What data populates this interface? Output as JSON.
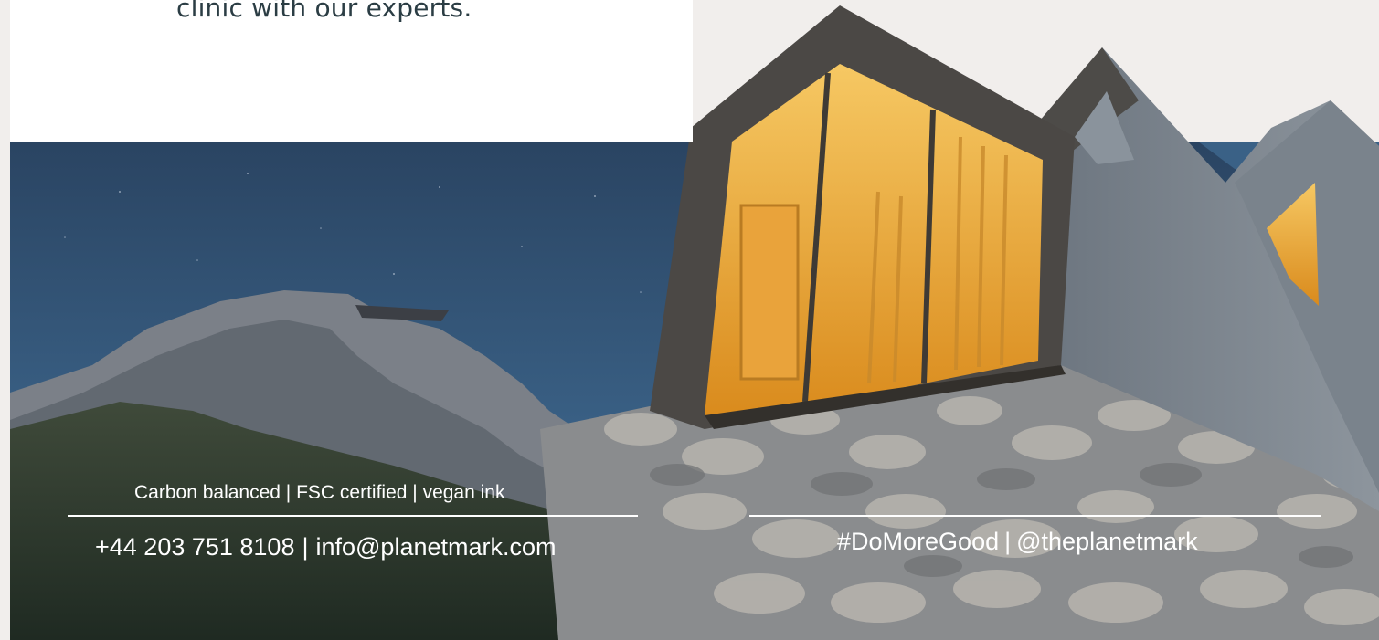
{
  "hero": {
    "tagline": "clinic with our experts."
  },
  "footer": {
    "cert_text": "Carbon balanced | FSC certified | vegan ink",
    "contact": {
      "phone": "+44 203 751 8108",
      "separator": "|",
      "email": "info@planetmark.com"
    },
    "social": {
      "hashtag": "#DoMoreGood",
      "separator": "|",
      "handle": "@theplanetmark"
    }
  },
  "colors": {
    "page_bg": "#f1eeec",
    "card_bg": "#ffffff",
    "text_dark": "#2b3d44",
    "sky_top": "#2b4565",
    "sky_bottom": "#3f6a8e",
    "window_glow": "#f0b23a"
  }
}
